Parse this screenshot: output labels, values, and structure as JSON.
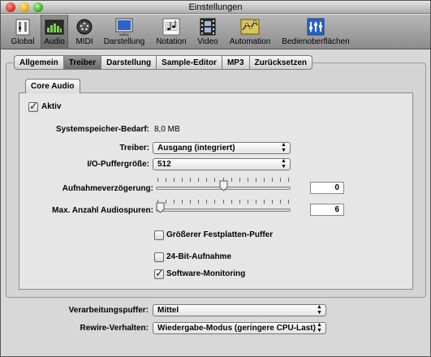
{
  "window": {
    "title": "Einstellungen"
  },
  "toolbar": {
    "items": [
      {
        "label": "Global",
        "icon": "global-icon"
      },
      {
        "label": "Audio",
        "icon": "audio-icon",
        "selected": true
      },
      {
        "label": "MIDI",
        "icon": "midi-icon"
      },
      {
        "label": "Darstellung",
        "icon": "display-icon"
      },
      {
        "label": "Notation",
        "icon": "notation-icon"
      },
      {
        "label": "Video",
        "icon": "video-icon"
      },
      {
        "label": "Automation",
        "icon": "automation-icon"
      },
      {
        "label": "Bedienoberflächen",
        "icon": "control-surfaces-icon"
      }
    ]
  },
  "tabs": [
    {
      "label": "Allgemein"
    },
    {
      "label": "Treiber",
      "active": true
    },
    {
      "label": "Darstellung"
    },
    {
      "label": "Sample-Editor"
    },
    {
      "label": "MP3"
    },
    {
      "label": "Zurücksetzen"
    }
  ],
  "core_audio": {
    "tab_label": "Core Audio",
    "active": {
      "label": "Aktiv",
      "checked": true
    },
    "memory": {
      "label": "Systemspeicher-Bedarf:",
      "value": "8,0 MB"
    },
    "driver": {
      "label": "Treiber:",
      "value": "Ausgang (integriert)"
    },
    "buffer": {
      "label": "I/O-Puffergröße:",
      "value": "512"
    },
    "delay": {
      "label": "Aufnahmeverzögerung:",
      "value": "0",
      "level": 0.5
    },
    "tracks": {
      "label": "Max. Anzahl Audiospuren:",
      "value": "6",
      "level": 0.0
    },
    "options": [
      {
        "label": "Größerer Festplatten-Puffer",
        "checked": false
      },
      {
        "label": "24-Bit-Aufnahme",
        "checked": false
      },
      {
        "label": "Software-Monitoring",
        "checked": true
      }
    ]
  },
  "processing": {
    "label": "Verarbeitungspuffer:",
    "value": "Mittel"
  },
  "rewire": {
    "label": "Rewire-Verhalten:",
    "value": "Wiedergabe-Modus (geringere CPU-Last)"
  },
  "colors": {
    "toolbar_top": "#b8b8b8",
    "toolbar_bottom": "#8c8c8c",
    "panel": "#e6e6e6",
    "icon_blue": "#2a64c8"
  }
}
